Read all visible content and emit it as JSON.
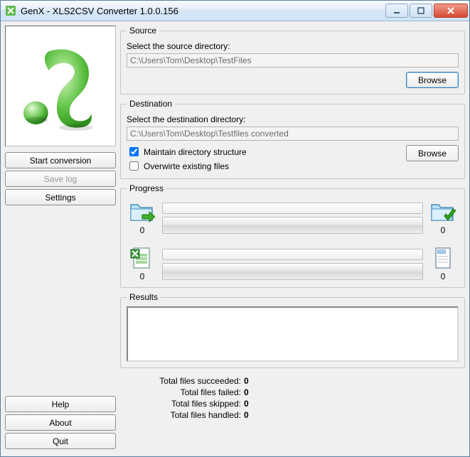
{
  "window": {
    "title": "GenX - XLS2CSV Converter 1.0.0.156"
  },
  "left": {
    "start_conversion": "Start conversion",
    "save_log": "Save log",
    "settings": "Settings",
    "help": "Help",
    "about": "About",
    "quit": "Quit"
  },
  "source": {
    "legend": "Source",
    "label": "Select the source directory:",
    "path": "C:\\Users\\Tom\\Desktop\\TestFiles",
    "browse": "Browse"
  },
  "destination": {
    "legend": "Destination",
    "label": "Select the destination directory:",
    "path": "C:\\Users\\Tom\\Desktop\\Testfiles converted",
    "maintain_structure": "Maintain directory structure",
    "overwrite": "Overwirte existing files",
    "browse": "Browse"
  },
  "progress": {
    "legend": "Progress",
    "row1_left_count": "0",
    "row1_right_count": "0",
    "row2_left_count": "0",
    "row2_right_count": "0"
  },
  "results": {
    "legend": "Results"
  },
  "totals": {
    "succeeded_label": "Total files succeeded:",
    "succeeded_value": "0",
    "failed_label": "Total files failed:",
    "failed_value": "0",
    "skipped_label": "Total files skipped:",
    "skipped_value": "0",
    "handled_label": "Total files handled:",
    "handled_value": "0"
  }
}
